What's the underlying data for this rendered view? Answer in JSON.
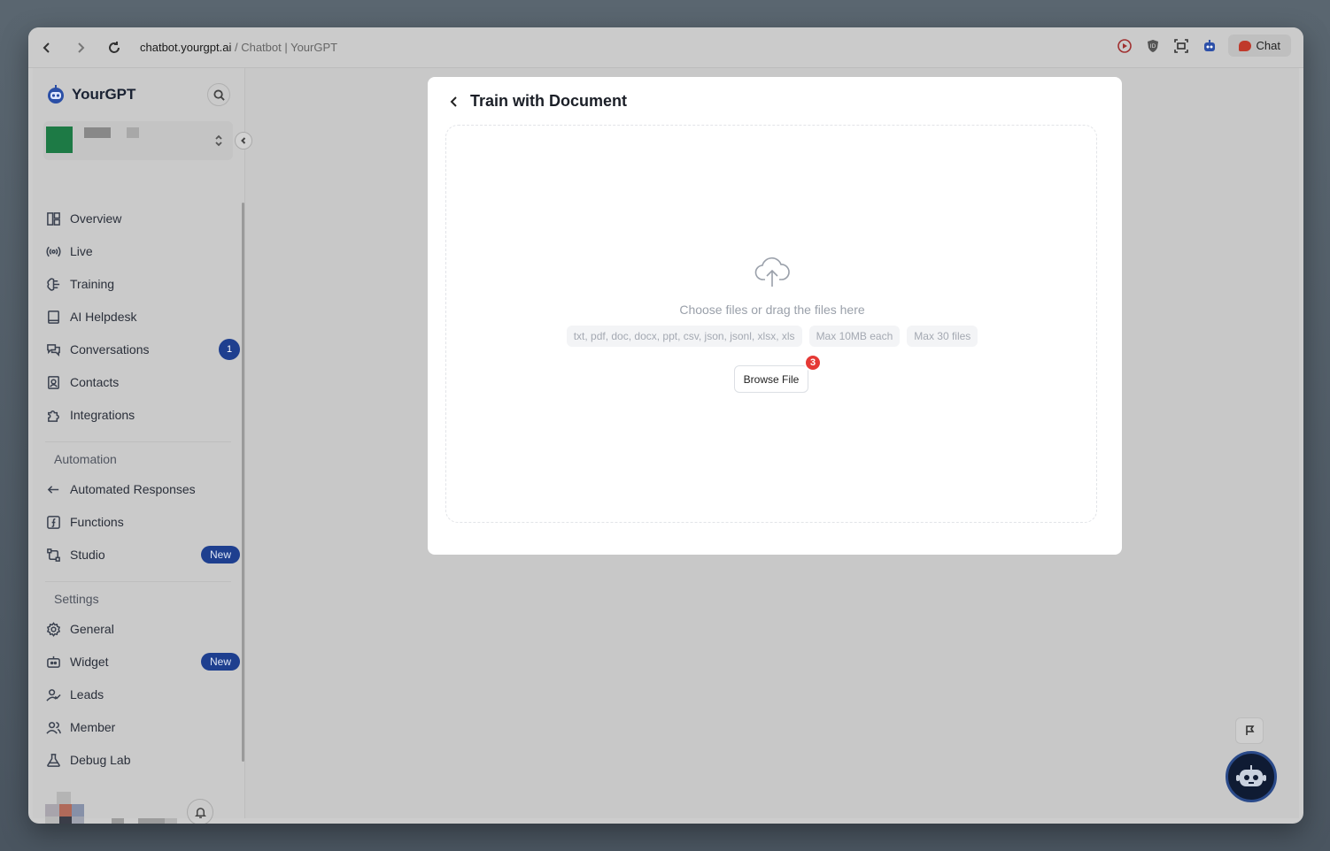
{
  "browser": {
    "domain": "chatbot.yourgpt.ai",
    "separator": " / ",
    "page_title": "Chatbot | YourGPT",
    "chat_label": "Chat"
  },
  "brand": {
    "name": "YourGPT"
  },
  "sidebar": {
    "main_items": [
      {
        "label": "Overview",
        "icon": "layout-icon"
      },
      {
        "label": "Live",
        "icon": "broadcast-icon"
      },
      {
        "label": "Training",
        "icon": "brain-icon"
      },
      {
        "label": "AI Helpdesk",
        "icon": "book-icon"
      },
      {
        "label": "Conversations",
        "icon": "chat-bubbles-icon",
        "badge": "1"
      },
      {
        "label": "Contacts",
        "icon": "contact-card-icon"
      },
      {
        "label": "Integrations",
        "icon": "puzzle-icon"
      }
    ],
    "automation_label": "Automation",
    "automation_items": [
      {
        "label": "Automated Responses",
        "icon": "reply-icon"
      },
      {
        "label": "Functions",
        "icon": "function-icon"
      },
      {
        "label": "Studio",
        "icon": "flow-icon",
        "badge": "New"
      }
    ],
    "settings_label": "Settings",
    "settings_items": [
      {
        "label": "General",
        "icon": "gear-icon"
      },
      {
        "label": "Widget",
        "icon": "widget-icon",
        "badge": "New"
      },
      {
        "label": "Leads",
        "icon": "user-check-icon"
      },
      {
        "label": "Member",
        "icon": "users-icon"
      },
      {
        "label": "Debug Lab",
        "icon": "flask-icon"
      }
    ]
  },
  "modal": {
    "title": "Train with Document",
    "drop_text": "Choose files or drag the files here",
    "chips": [
      "txt, pdf, doc, docx, ppt, csv, json, jsonl, xlsx, xls",
      "Max 10MB each",
      "Max 30 files"
    ],
    "browse_label": "Browse File",
    "step_badge": "3"
  },
  "colors": {
    "accent": "#1e3f8f",
    "step_badge": "#e53935",
    "workspace_avatar": "#1d7a45"
  }
}
